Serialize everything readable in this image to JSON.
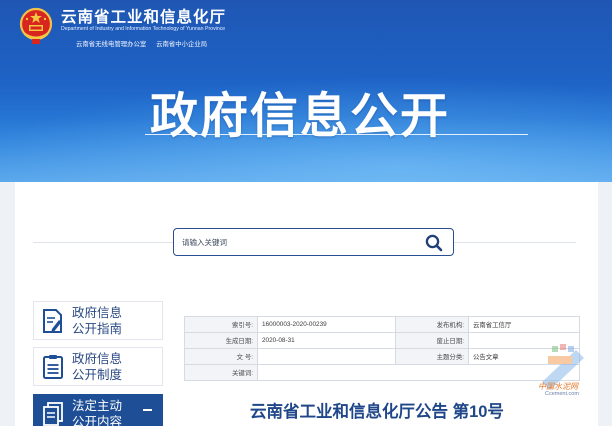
{
  "header": {
    "site_title": "云南省工业和信息化厅",
    "site_subtitle": "Department of Industry and Information Technology of Yunnan Province",
    "offices": [
      "云南省无线电管理办公室",
      "云南省中小企业局"
    ],
    "hero_title": "政府信息公开"
  },
  "search": {
    "placeholder": "请输入关键词"
  },
  "nav": {
    "items": [
      {
        "line1": "政府信息",
        "line2": "公开指南",
        "icon": "document-pen-icon"
      },
      {
        "line1": "政府信息",
        "line2": "公开制度",
        "icon": "clipboard-list-icon"
      },
      {
        "line1": "法定主动",
        "line2": "公开内容",
        "icon": "documents-icon",
        "active": true
      }
    ]
  },
  "meta": {
    "index_no_label": "索引号:",
    "index_no": "16000003-2020-00239",
    "publisher_label": "发布机构:",
    "publisher": "云南省工信厅",
    "date_label": "生成日期:",
    "date": "2020-08-31",
    "expiry_label": "废止日期:",
    "expiry": "",
    "doc_no_label": "文 号:",
    "doc_no": "",
    "category_label": "主题分类:",
    "category": "公告文章",
    "keywords_label": "关键词:",
    "keywords": ""
  },
  "document": {
    "title": "云南省工业和信息化厅公告 第10号"
  },
  "watermark": {
    "line1": "中国水泥网",
    "line2": "Ccement.com"
  },
  "colors": {
    "banner": "#1f56b3",
    "nav_active": "#1e4f96",
    "text_blue": "#2a4a83",
    "title_blue": "#1f4689"
  }
}
